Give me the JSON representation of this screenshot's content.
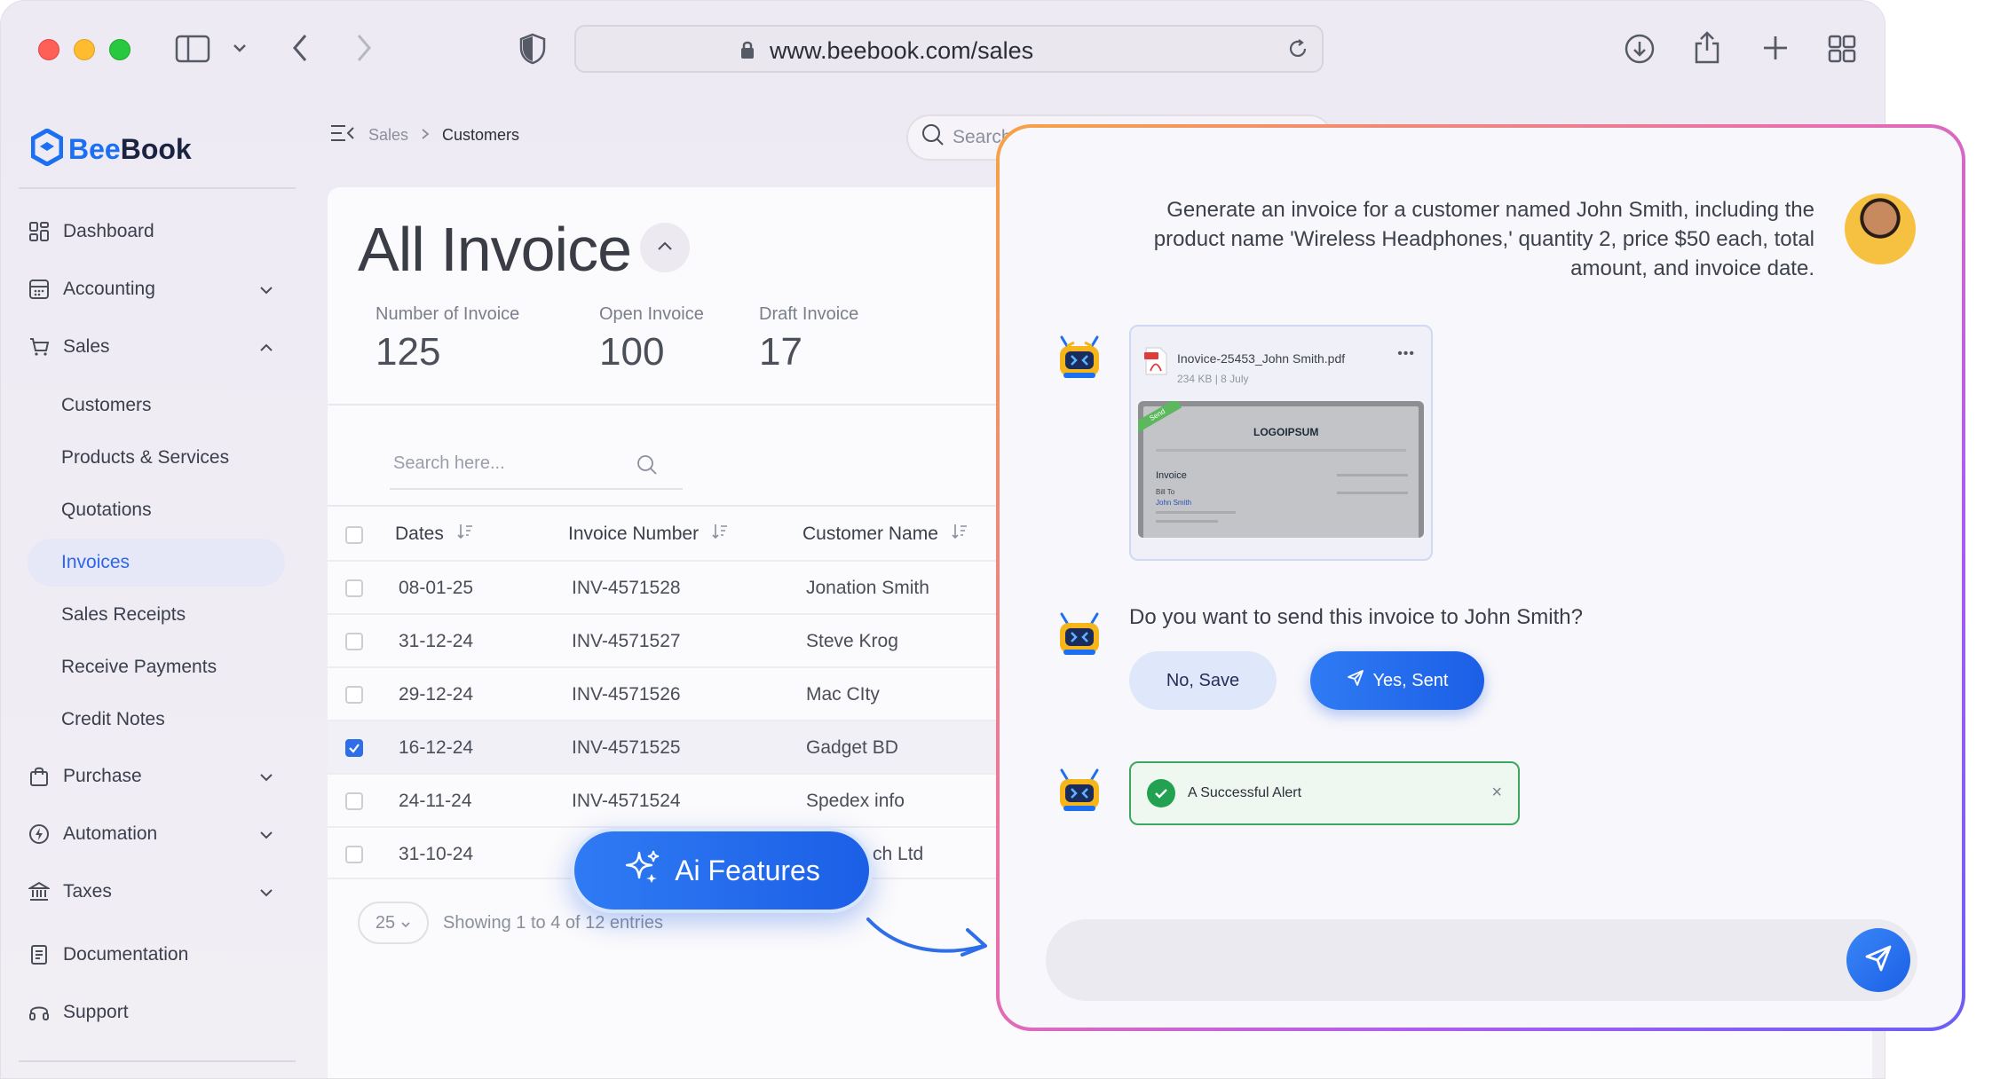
{
  "browser": {
    "url": "www.beebook.com/sales"
  },
  "brand": {
    "name_prefix": "Bee",
    "name_suffix": "Book",
    "accent": "#1b6ff2"
  },
  "sidebar": {
    "items": [
      {
        "label": "Dashboard",
        "icon": "grid-icon"
      },
      {
        "label": "Accounting",
        "icon": "calculator-icon"
      },
      {
        "label": "Sales",
        "icon": "cart-icon"
      },
      {
        "label": "Purchase",
        "icon": "bag-icon"
      },
      {
        "label": "Automation",
        "icon": "automation-icon"
      },
      {
        "label": "Taxes",
        "icon": "bank-icon"
      },
      {
        "label": "Documentation",
        "icon": "document-icon"
      },
      {
        "label": "Support",
        "icon": "headset-icon"
      }
    ],
    "sales_sub": [
      "Customers",
      "Products & Services",
      "Quotations",
      "Invoices",
      "Sales Receipts",
      "Receive Payments",
      "Credit Notes"
    ],
    "active_sub": "Invoices"
  },
  "breadcrumb": {
    "parent": "Sales",
    "current": "Customers"
  },
  "topbar": {
    "search_placeholder": "Search"
  },
  "main": {
    "title": "All Invoice",
    "stats": [
      {
        "label": "Number of Invoice",
        "value": "125"
      },
      {
        "label": "Open Invoice",
        "value": "100"
      },
      {
        "label": "Draft Invoice",
        "value": "17"
      }
    ],
    "search_placeholder": "Search here...",
    "columns": [
      "Dates",
      "Invoice Number",
      "Customer Name"
    ],
    "rows": [
      {
        "date": "08-01-25",
        "invoice": "INV-4571528",
        "customer": "Jonation Smith",
        "checked": false
      },
      {
        "date": "31-12-24",
        "invoice": "INV-4571527",
        "customer": "Steve Krog",
        "checked": false
      },
      {
        "date": "29-12-24",
        "invoice": "INV-4571526",
        "customer": "Mac CIty",
        "checked": false
      },
      {
        "date": "16-12-24",
        "invoice": "INV-4571525",
        "customer": "Gadget BD",
        "checked": true
      },
      {
        "date": "24-11-24",
        "invoice": "INV-4571524",
        "customer": "Spedex info",
        "checked": false
      },
      {
        "date": "31-10-24",
        "invoice": "",
        "customer": "ch Ltd",
        "checked": false
      }
    ],
    "page_size": "25",
    "showing": "Showing 1 to 4 of 12 entries"
  },
  "ai_button": {
    "label": "Ai Features"
  },
  "chat": {
    "user_message": "Generate an invoice for a customer named John Smith, including the product name 'Wireless Headphones,' quantity 2, price $50 each, total amount, and invoice date.",
    "file": {
      "name": "Inovice-25453_John Smith.pdf",
      "meta": "234 KB | 8 July",
      "logo": "LOGOIPSUM",
      "doc_title": "Invoice",
      "bill_to": "Bill To",
      "bill_name": "John Smith",
      "ribbon": "Send"
    },
    "question": "Do you want to send this invoice to John Smith?",
    "no_label": "No, Save",
    "yes_label": "Yes, Sent",
    "alert": "A Successful Alert",
    "alert_close": "×"
  }
}
